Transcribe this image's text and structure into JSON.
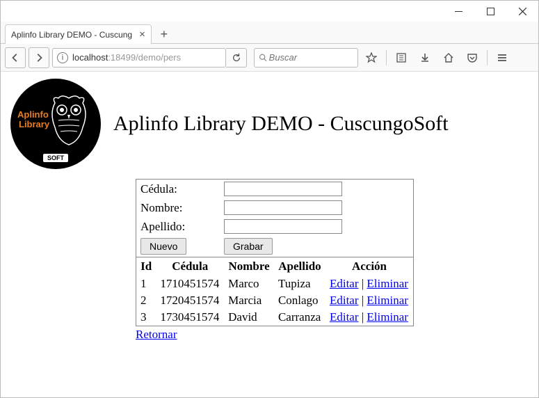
{
  "window": {
    "tab_title": "Aplinfo Library DEMO - Cuscung"
  },
  "toolbar": {
    "url_host": "localhost",
    "url_rest": ":18499/demo/pers",
    "search_placeholder": "Buscar"
  },
  "logo": {
    "line1": "Aplinfo",
    "line2": "Library",
    "soft": "SOFT"
  },
  "page_title": "Aplinfo Library DEMO - CuscungoSoft",
  "form": {
    "cedula_label": "Cédula:",
    "nombre_label": "Nombre:",
    "apellido_label": "Apellido:",
    "nuevo_btn": "Nuevo",
    "grabar_btn": "Grabar",
    "cedula_value": "",
    "nombre_value": "",
    "apellido_value": ""
  },
  "table": {
    "headers": {
      "id": "Id",
      "cedula": "Cédula",
      "nombre": "Nombre",
      "apellido": "Apellido",
      "accion": "Acción"
    },
    "action_edit": "Editar",
    "action_delete": "Eliminar",
    "rows": [
      {
        "id": "1",
        "cedula": "1710451574",
        "nombre": "Marco",
        "apellido": "Tupiza"
      },
      {
        "id": "2",
        "cedula": "1720451574",
        "nombre": "Marcia",
        "apellido": "Conlago"
      },
      {
        "id": "3",
        "cedula": "1730451574",
        "nombre": "David",
        "apellido": "Carranza"
      }
    ]
  },
  "return_link": "Retornar"
}
